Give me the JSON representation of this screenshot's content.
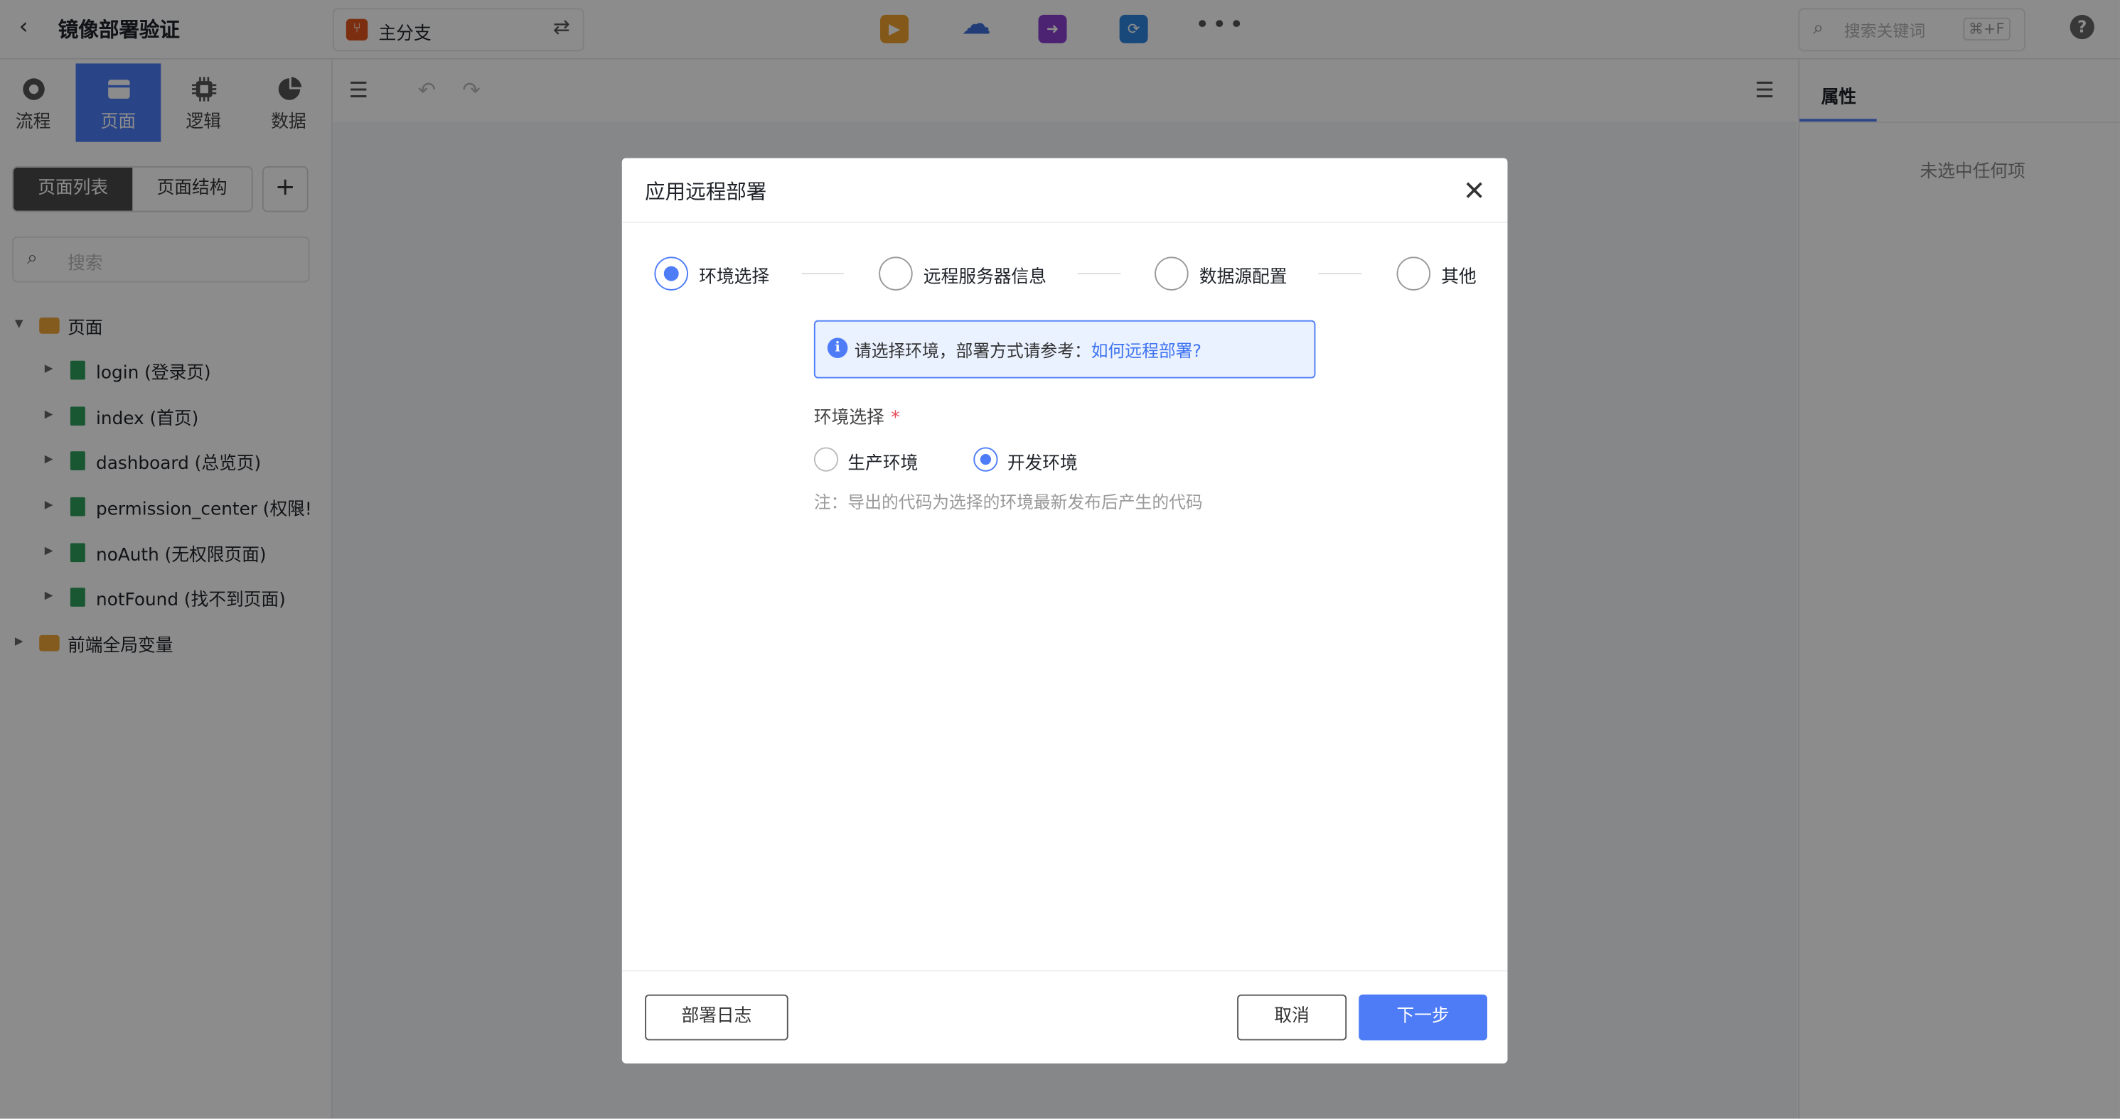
{
  "header": {
    "back_icon": "chevron-left-icon",
    "project_title": "镜像部署验证",
    "branch": {
      "name": "主分支",
      "icon": "branch-icon",
      "swap_icon": "swap-icon"
    },
    "tools": [
      {
        "name": "play-icon",
        "color": "#f0a02c",
        "glyph": "▶"
      },
      {
        "name": "cloud-icon",
        "color": "#3d6ed8",
        "glyph": "☁"
      },
      {
        "name": "arrow-right-icon",
        "color": "#8a3fd1",
        "glyph": "➜"
      },
      {
        "name": "refresh-icon",
        "color": "#2f83e0",
        "glyph": "⟳"
      }
    ],
    "more_glyph": "•••",
    "search": {
      "placeholder": "搜索关键词",
      "shortcut": "⌘+F"
    },
    "help_glyph": "?"
  },
  "left_rail": {
    "tabs": [
      {
        "label": "流程",
        "icon": "process-icon",
        "active": false
      },
      {
        "label": "页面",
        "icon": "page-icon",
        "active": true
      },
      {
        "label": "逻辑",
        "icon": "chip-icon",
        "active": false
      },
      {
        "label": "数据",
        "icon": "pie-chart-icon",
        "active": false
      }
    ]
  },
  "page_panel": {
    "segments": [
      "页面列表",
      "页面结构"
    ],
    "add_glyph": "+",
    "search_placeholder": "搜索",
    "tree": {
      "root": "页面",
      "pages": [
        "login (登录页)",
        "index (首页)",
        "dashboard (总览页)",
        "permission_center (权限!",
        "noAuth (无权限页面)",
        "notFound (找不到页面)"
      ],
      "globals": "前端全局变量"
    }
  },
  "properties": {
    "tab": "属性",
    "empty": "未选中任何项"
  },
  "dialog": {
    "title": "应用远程部署",
    "steps": [
      "环境选择",
      "远程服务器信息",
      "数据源配置",
      "其他"
    ],
    "active_step": 0,
    "alert": {
      "text": "请选择环境，部署方式请参考：",
      "link": "如何远程部署?"
    },
    "field_label": "环境选择",
    "required_mark": "*",
    "options": [
      "生产环境",
      "开发环境"
    ],
    "selected_option": 1,
    "note": "注：导出的代码为选择的环境最新发布后产生的代码",
    "buttons": {
      "log": "部署日志",
      "cancel": "取消",
      "next": "下一步"
    }
  },
  "colors": {
    "accent": "#4e7cf7",
    "overlay": "rgba(0,0,0,0.45)"
  }
}
